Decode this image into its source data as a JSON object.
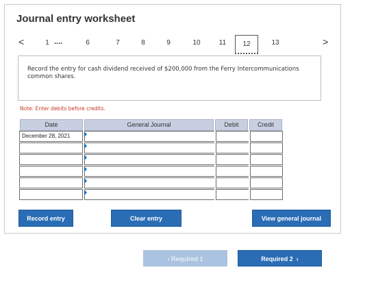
{
  "title": "Journal entry worksheet",
  "nav": {
    "prev_arrow": "<",
    "next_arrow": ">",
    "first": "1",
    "ellipsis": "....",
    "items": [
      "6",
      "7",
      "8",
      "9",
      "10",
      "11",
      "12",
      "13"
    ],
    "active": "12"
  },
  "prompt": "Record the entry for cash dividend received of $200,000 from the Ferry Intercommunications common shares.",
  "note": "Note: Enter debits before credits.",
  "journal": {
    "headers": {
      "date": "Date",
      "general_journal": "General Journal",
      "debit": "Debit",
      "credit": "Credit"
    },
    "rows": [
      {
        "date": "December 28, 2021",
        "account": "",
        "debit": "",
        "credit": ""
      },
      {
        "date": "",
        "account": "",
        "debit": "",
        "credit": ""
      },
      {
        "date": "",
        "account": "",
        "debit": "",
        "credit": ""
      },
      {
        "date": "",
        "account": "",
        "debit": "",
        "credit": ""
      },
      {
        "date": "",
        "account": "",
        "debit": "",
        "credit": ""
      },
      {
        "date": "",
        "account": "",
        "debit": "",
        "credit": ""
      }
    ]
  },
  "buttons": {
    "record": "Record entry",
    "clear": "Clear entry",
    "view": "View general journal",
    "required1": "Required 1",
    "required2": "Required 2"
  },
  "colors": {
    "accent": "#2a6db5",
    "header_bg": "#c7cfe0",
    "note": "#c0392b"
  }
}
